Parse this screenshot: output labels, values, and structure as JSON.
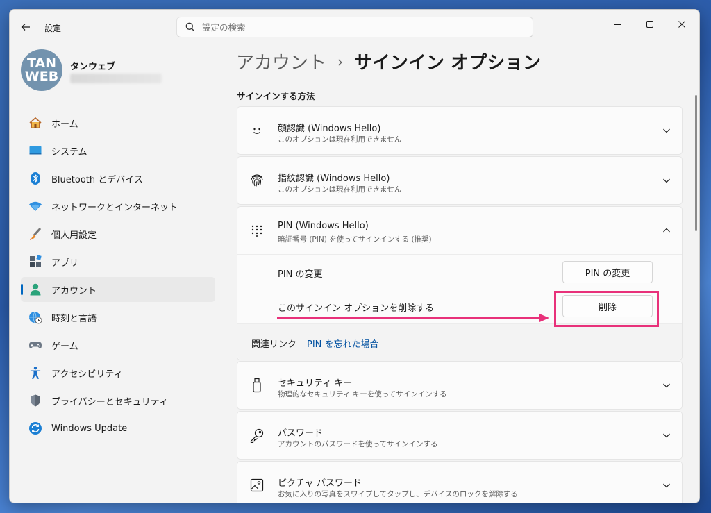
{
  "window": {
    "title": "設定"
  },
  "search": {
    "placeholder": "設定の検索"
  },
  "user": {
    "avatar_line1": "TAN",
    "avatar_line2": "WEB",
    "name": "タンウェブ"
  },
  "sidebar": {
    "items": [
      {
        "label": "ホーム",
        "icon": "home-icon"
      },
      {
        "label": "システム",
        "icon": "system-icon"
      },
      {
        "label": "Bluetooth とデバイス",
        "icon": "bluetooth-icon"
      },
      {
        "label": "ネットワークとインターネット",
        "icon": "network-icon"
      },
      {
        "label": "個人用設定",
        "icon": "brush-icon"
      },
      {
        "label": "アプリ",
        "icon": "apps-icon"
      },
      {
        "label": "アカウント",
        "icon": "account-icon",
        "active": true
      },
      {
        "label": "時刻と言語",
        "icon": "globe-clock-icon"
      },
      {
        "label": "ゲーム",
        "icon": "gamepad-icon"
      },
      {
        "label": "アクセシビリティ",
        "icon": "accessibility-icon"
      },
      {
        "label": "プライバシーとセキュリティ",
        "icon": "shield-icon"
      },
      {
        "label": "Windows Update",
        "icon": "update-icon"
      }
    ]
  },
  "breadcrumb": {
    "parent": "アカウント",
    "separator": "›",
    "current": "サインイン オプション"
  },
  "main": {
    "section_title": "サインインする方法",
    "face": {
      "title": "顔認識 (Windows Hello)",
      "subtitle": "このオプションは現在利用できません"
    },
    "fingerprint": {
      "title": "指紋認識 (Windows Hello)",
      "subtitle": "このオプションは現在利用できません"
    },
    "pin": {
      "title": "PIN (Windows Hello)",
      "subtitle": "暗証番号 (PIN) を使ってサインインする (推奨)",
      "change_label": "PIN の変更",
      "change_button": "PIN の変更",
      "remove_label": "このサインイン オプションを削除する",
      "remove_button": "削除",
      "related_label": "関連リンク",
      "related_link": "PIN を忘れた場合"
    },
    "security_key": {
      "title": "セキュリティ キー",
      "subtitle": "物理的なセキュリティ キーを使ってサインインする"
    },
    "password": {
      "title": "パスワード",
      "subtitle": "アカウントのパスワードを使ってサインインする"
    },
    "picture_password": {
      "title": "ピクチャ パスワード",
      "subtitle": "お気に入りの写真をスワイプしてタップし、デバイスのロックを解除する"
    }
  },
  "colors": {
    "accent": "#0067c0",
    "highlight": "#e8317a",
    "link": "#0050a0"
  }
}
